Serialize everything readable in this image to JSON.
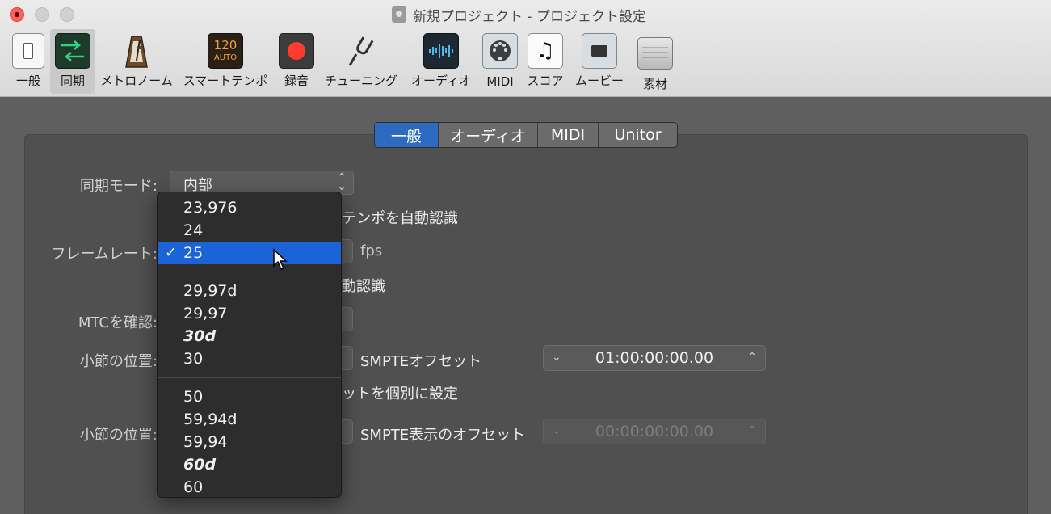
{
  "window": {
    "title": "新規プロジェクト - プロジェクト設定"
  },
  "toolbar": [
    {
      "label": "一般",
      "icon": "general-icon"
    },
    {
      "label": "同期",
      "icon": "sync-icon",
      "selected": true
    },
    {
      "label": "メトロノーム",
      "icon": "metronome-icon"
    },
    {
      "label": "スマートテンポ",
      "icon": "smart-tempo-icon",
      "icon_text_top": "120",
      "icon_text_bottom": "AUTO"
    },
    {
      "label": "録音",
      "icon": "record-icon"
    },
    {
      "label": "チューニング",
      "icon": "tuning-fork-icon"
    },
    {
      "label": "オーディオ",
      "icon": "audio-waveform-icon"
    },
    {
      "label": "MIDI",
      "icon": "midi-port-icon"
    },
    {
      "label": "スコア",
      "icon": "music-note-icon",
      "icon_glyph": "♫"
    },
    {
      "label": "ムービー",
      "icon": "movie-camera-icon"
    },
    {
      "label": "素材",
      "icon": "assets-case-icon"
    }
  ],
  "tabs": [
    {
      "label": "一般",
      "active": true
    },
    {
      "label": "オーディオ"
    },
    {
      "label": "MIDI"
    },
    {
      "label": "Unitor"
    }
  ],
  "form": {
    "sync_mode_label": "同期モード:",
    "sync_mode_value": "内部",
    "auto_tempo_text": "テンポを自動認識",
    "frame_rate_label": "フレームレート:",
    "fps_unit": "fps",
    "auto_detect_text": "動認識",
    "mtc_label": "MTCを確認:",
    "bar_position_label": "小節の位置:",
    "smpte_offset_label": "SMPTEオフセット",
    "smpte_offset_value": "01:00:00:00.00",
    "separate_offset_text": "ットを個別に設定",
    "bar_position_label_2": "小節の位置:",
    "smpte_display_offset_label": "SMPTE表示のオフセット",
    "smpte_display_offset_value": "00:00:00:00.00"
  },
  "dropdown": {
    "groups": [
      [
        {
          "label": "23,976"
        },
        {
          "label": "24"
        },
        {
          "label": "25",
          "selected": true
        }
      ],
      [
        {
          "label": "29,97d"
        },
        {
          "label": "29,97"
        },
        {
          "label": "30d",
          "italic": true
        },
        {
          "label": "30"
        }
      ],
      [
        {
          "label": "50"
        },
        {
          "label": "59,94d"
        },
        {
          "label": "59,94"
        },
        {
          "label": "60d",
          "italic": true
        },
        {
          "label": "60"
        }
      ]
    ],
    "check_glyph": "✓",
    "selected_value": "25"
  }
}
